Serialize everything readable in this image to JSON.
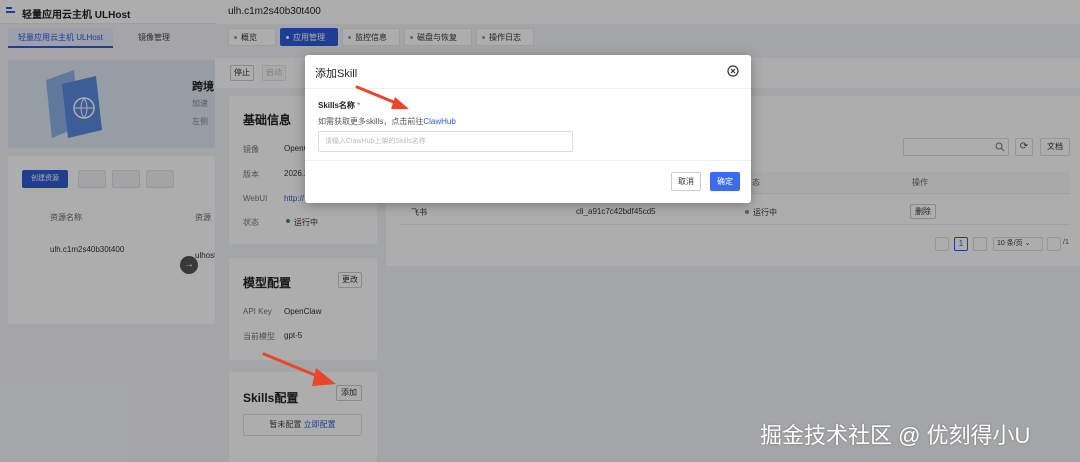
{
  "background_app": {
    "title": "轻量应用云主机 ULHost",
    "tabs": [
      "轻量应用云主机 ULHost",
      "镜像管理"
    ],
    "banner_title": "跨境",
    "banner_sub1": "加速",
    "banner_sub2": "左侧",
    "create_button": "创建资源",
    "col_name": "资源名称",
    "col_host": "资源",
    "row_name": "ulh.c1m2s40b30t400",
    "row_host": "ulhost"
  },
  "drawer": {
    "title": "ulh.c1m2s40b30t400",
    "tabs": [
      {
        "label": "概览",
        "active": false
      },
      {
        "label": "应用管理",
        "active": true
      },
      {
        "label": "监控信息",
        "active": false
      },
      {
        "label": "磁盘与恢复",
        "active": false
      },
      {
        "label": "操作日志",
        "active": false
      }
    ],
    "toolbar": {
      "stop": "停止",
      "start": "启动"
    },
    "basic_info": {
      "title": "基础信息",
      "image_label": "镜像",
      "image_value": "OpenC",
      "version_label": "版本",
      "version_value": "2026.2",
      "webui_label": "WebUI",
      "webui_value": "http://",
      "status_label": "状态",
      "status_value": "运行中"
    },
    "model_config": {
      "title": "模型配置",
      "edit_button": "更改",
      "api_key_label": "API Key",
      "api_key_value": "OpenClaw",
      "current_model_label": "当前模型",
      "current_model_value": "gpt-5"
    },
    "skills_config": {
      "title": "Skills配置",
      "add_button": "添加",
      "empty_text": "暂未配置",
      "empty_link": "立即配置"
    },
    "channel_table": {
      "doc_button": "文档",
      "refresh_icon": "refresh-icon",
      "col_status": "态",
      "col_action": "操作",
      "row": {
        "name": "飞书",
        "id": "cli_a91c7c42bdf45cd5",
        "status": "运行中",
        "delete": "删除"
      },
      "pagination": {
        "current": "1",
        "page_size": "10 条/页",
        "total": "/1"
      }
    }
  },
  "modal": {
    "title": "添加Skill",
    "field_label": "Skills名称",
    "required_mark": "*",
    "hint_text": "如需获取更多skills，点击前往",
    "hint_link": "ClawHub",
    "input_placeholder": "请输入ClawHub上架的Skills名称",
    "input_value": "",
    "cancel": "取消",
    "confirm": "确定"
  },
  "watermark": "掘金技术社区 @ 优刻得小U",
  "colors": {
    "primary": "#2e5bd8",
    "confirm": "#3b6cf0",
    "annotation_arrow": "#e8472a"
  }
}
